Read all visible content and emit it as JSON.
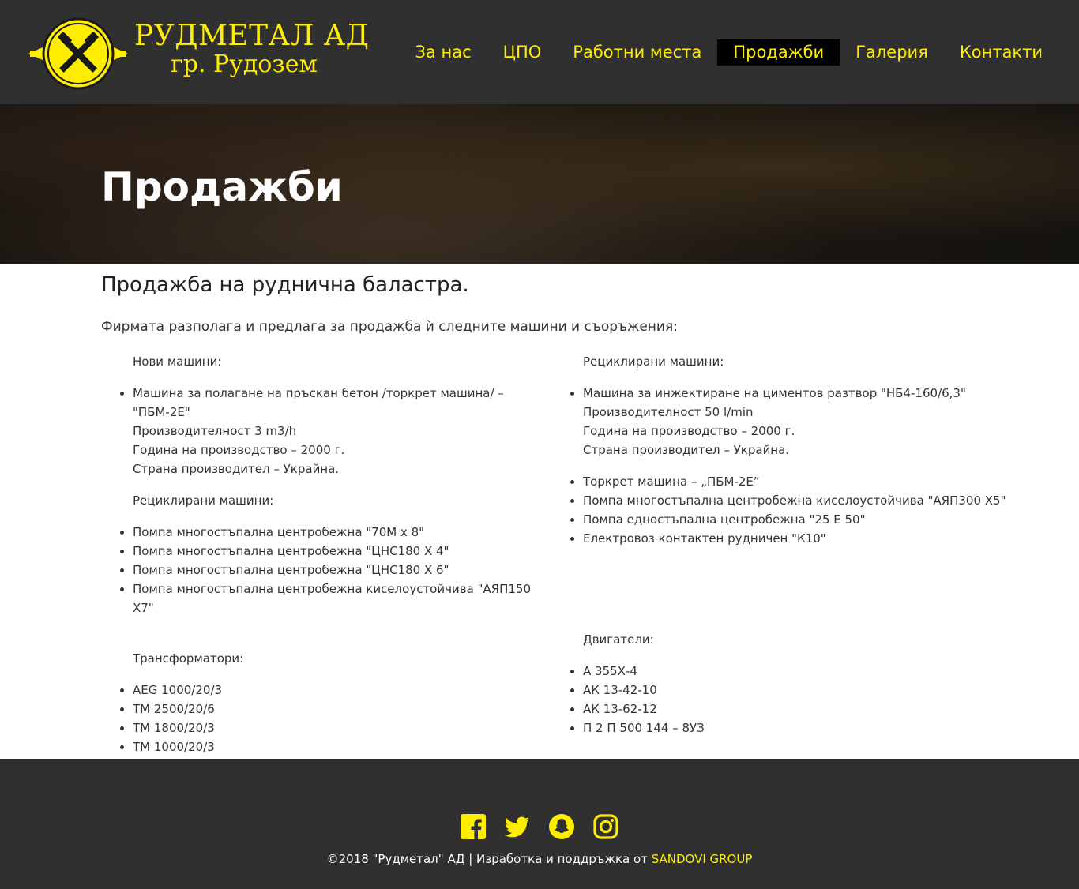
{
  "brand": {
    "name": "РУДМЕТАЛ АД",
    "city": "гр. Рудозем"
  },
  "nav": [
    {
      "label": "За нас"
    },
    {
      "label": "ЦПО"
    },
    {
      "label": "Работни места"
    },
    {
      "label": "Продажби",
      "active": true
    },
    {
      "label": "Галерия"
    },
    {
      "label": "Контакти"
    }
  ],
  "hero": {
    "title": "Продажби"
  },
  "content": {
    "heading": "Продажба на руднична баластра.",
    "intro": "Фирмата разполага и предлага за продажба ѝ следните машини и съоръжения:",
    "left": {
      "new_title": "Нови машини:",
      "new_item": [
        "Машина за полагане на пръскан бетон /торкрет машина/ –",
        "\"ПБМ-2Е\"",
        "Производителност 3 m3/h",
        "Година на производство – 2000 г.",
        "Страна производител – Украйна."
      ],
      "recycled_title": "Рециклирани машини:",
      "recycled": [
        "Помпа многостъпална центробежна \"70М х 8\"",
        "Помпа многостъпална центробежна \"ЦНС180 Х 4\"",
        "Помпа многостъпална центробежна \"ЦНС180 Х 6\"",
        "Помпа многостъпална центробежна киселоустойчива \"АЯП150 Х7\""
      ],
      "transformers_title": "Трансформатори:",
      "transformers": [
        "AEG 1000/20/3",
        "ТМ 2500/20/6",
        "ТМ 1800/20/3",
        "ТМ 1000/20/3"
      ]
    },
    "right": {
      "recycled_title": "Рециклирани машини:",
      "first_item": [
        "Машина за инжектиране на циментов разтвор \"НБ4-160/6,3\"",
        "Производителност 50 l/min",
        "Година на производство – 2000 г.",
        "Страна производител – Украйна."
      ],
      "others": [
        "Торкрет машина – „ПБМ-2Е”",
        "Помпа многостъпална центробежна киселоустойчива \"АЯП300 Х5\"",
        "Помпа едностъпална центробежна \"25 Е 50\"",
        "Електровоз контактен рудничен \"К10\""
      ],
      "engines_title": "Двигатели:",
      "engines": [
        "А 355Х-4",
        "АК 13-42-10",
        "АК 13-62-12",
        "П 2 П 500 144 – 8УЗ"
      ]
    }
  },
  "footer": {
    "copyright": "©2018 \"Рудметал\" АД | Изработка и поддръжка от ",
    "dev": "SANDOVI GROUP",
    "socials": [
      "facebook-icon",
      "twitter-icon",
      "snapchat-icon",
      "instagram-icon"
    ]
  },
  "colors": {
    "accent": "#ffed00",
    "header_bg": "#303030"
  }
}
